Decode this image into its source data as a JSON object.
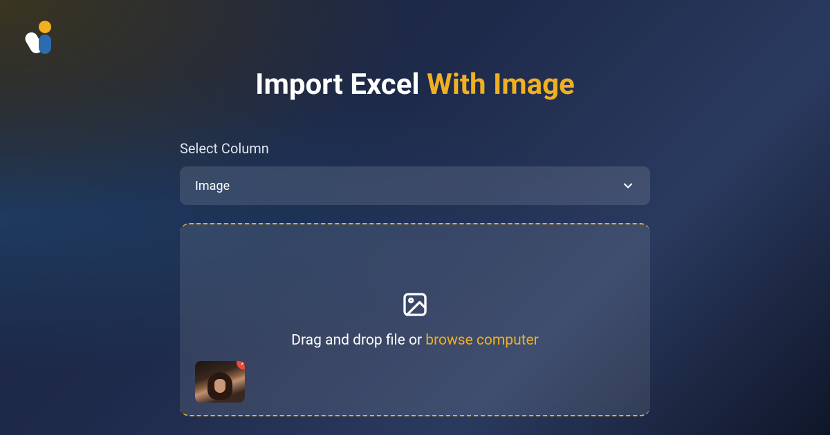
{
  "title": {
    "part1": "Import Excel",
    "part2": "With Image"
  },
  "form": {
    "column_label": "Select Column",
    "column_value": "Image"
  },
  "upload": {
    "text": "Drag and drop file or ",
    "link": "browse computer"
  },
  "colors": {
    "accent": "#f0b020",
    "remove": "#e74c3c"
  }
}
